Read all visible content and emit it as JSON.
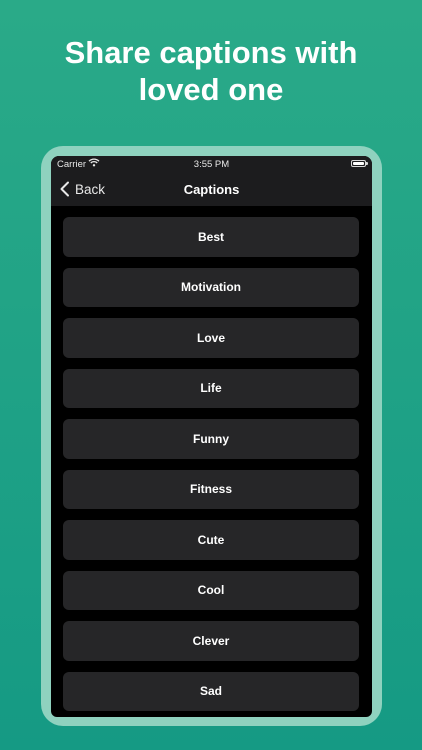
{
  "headline": {
    "line1": "Share captions with",
    "line2": "loved one"
  },
  "status_bar": {
    "carrier": "Carrier",
    "time": "3:55 PM",
    "wifi_icon": "wifi-icon",
    "battery_icon": "battery-icon"
  },
  "nav_bar": {
    "back_label": "Back",
    "back_icon": "chevron-left-icon",
    "title": "Captions"
  },
  "captions": [
    {
      "label": "Best"
    },
    {
      "label": "Motivation"
    },
    {
      "label": "Love"
    },
    {
      "label": "Life"
    },
    {
      "label": "Funny"
    },
    {
      "label": "Fitness"
    },
    {
      "label": "Cute"
    },
    {
      "label": "Cool"
    },
    {
      "label": "Clever"
    },
    {
      "label": "Sad"
    }
  ],
  "colors": {
    "background": "#1aa086",
    "device_frame": "#8fd2bf",
    "screen_bg": "#000000",
    "bar_bg": "#1c1c1e",
    "item_bg": "#262628",
    "text": "#ffffff"
  }
}
